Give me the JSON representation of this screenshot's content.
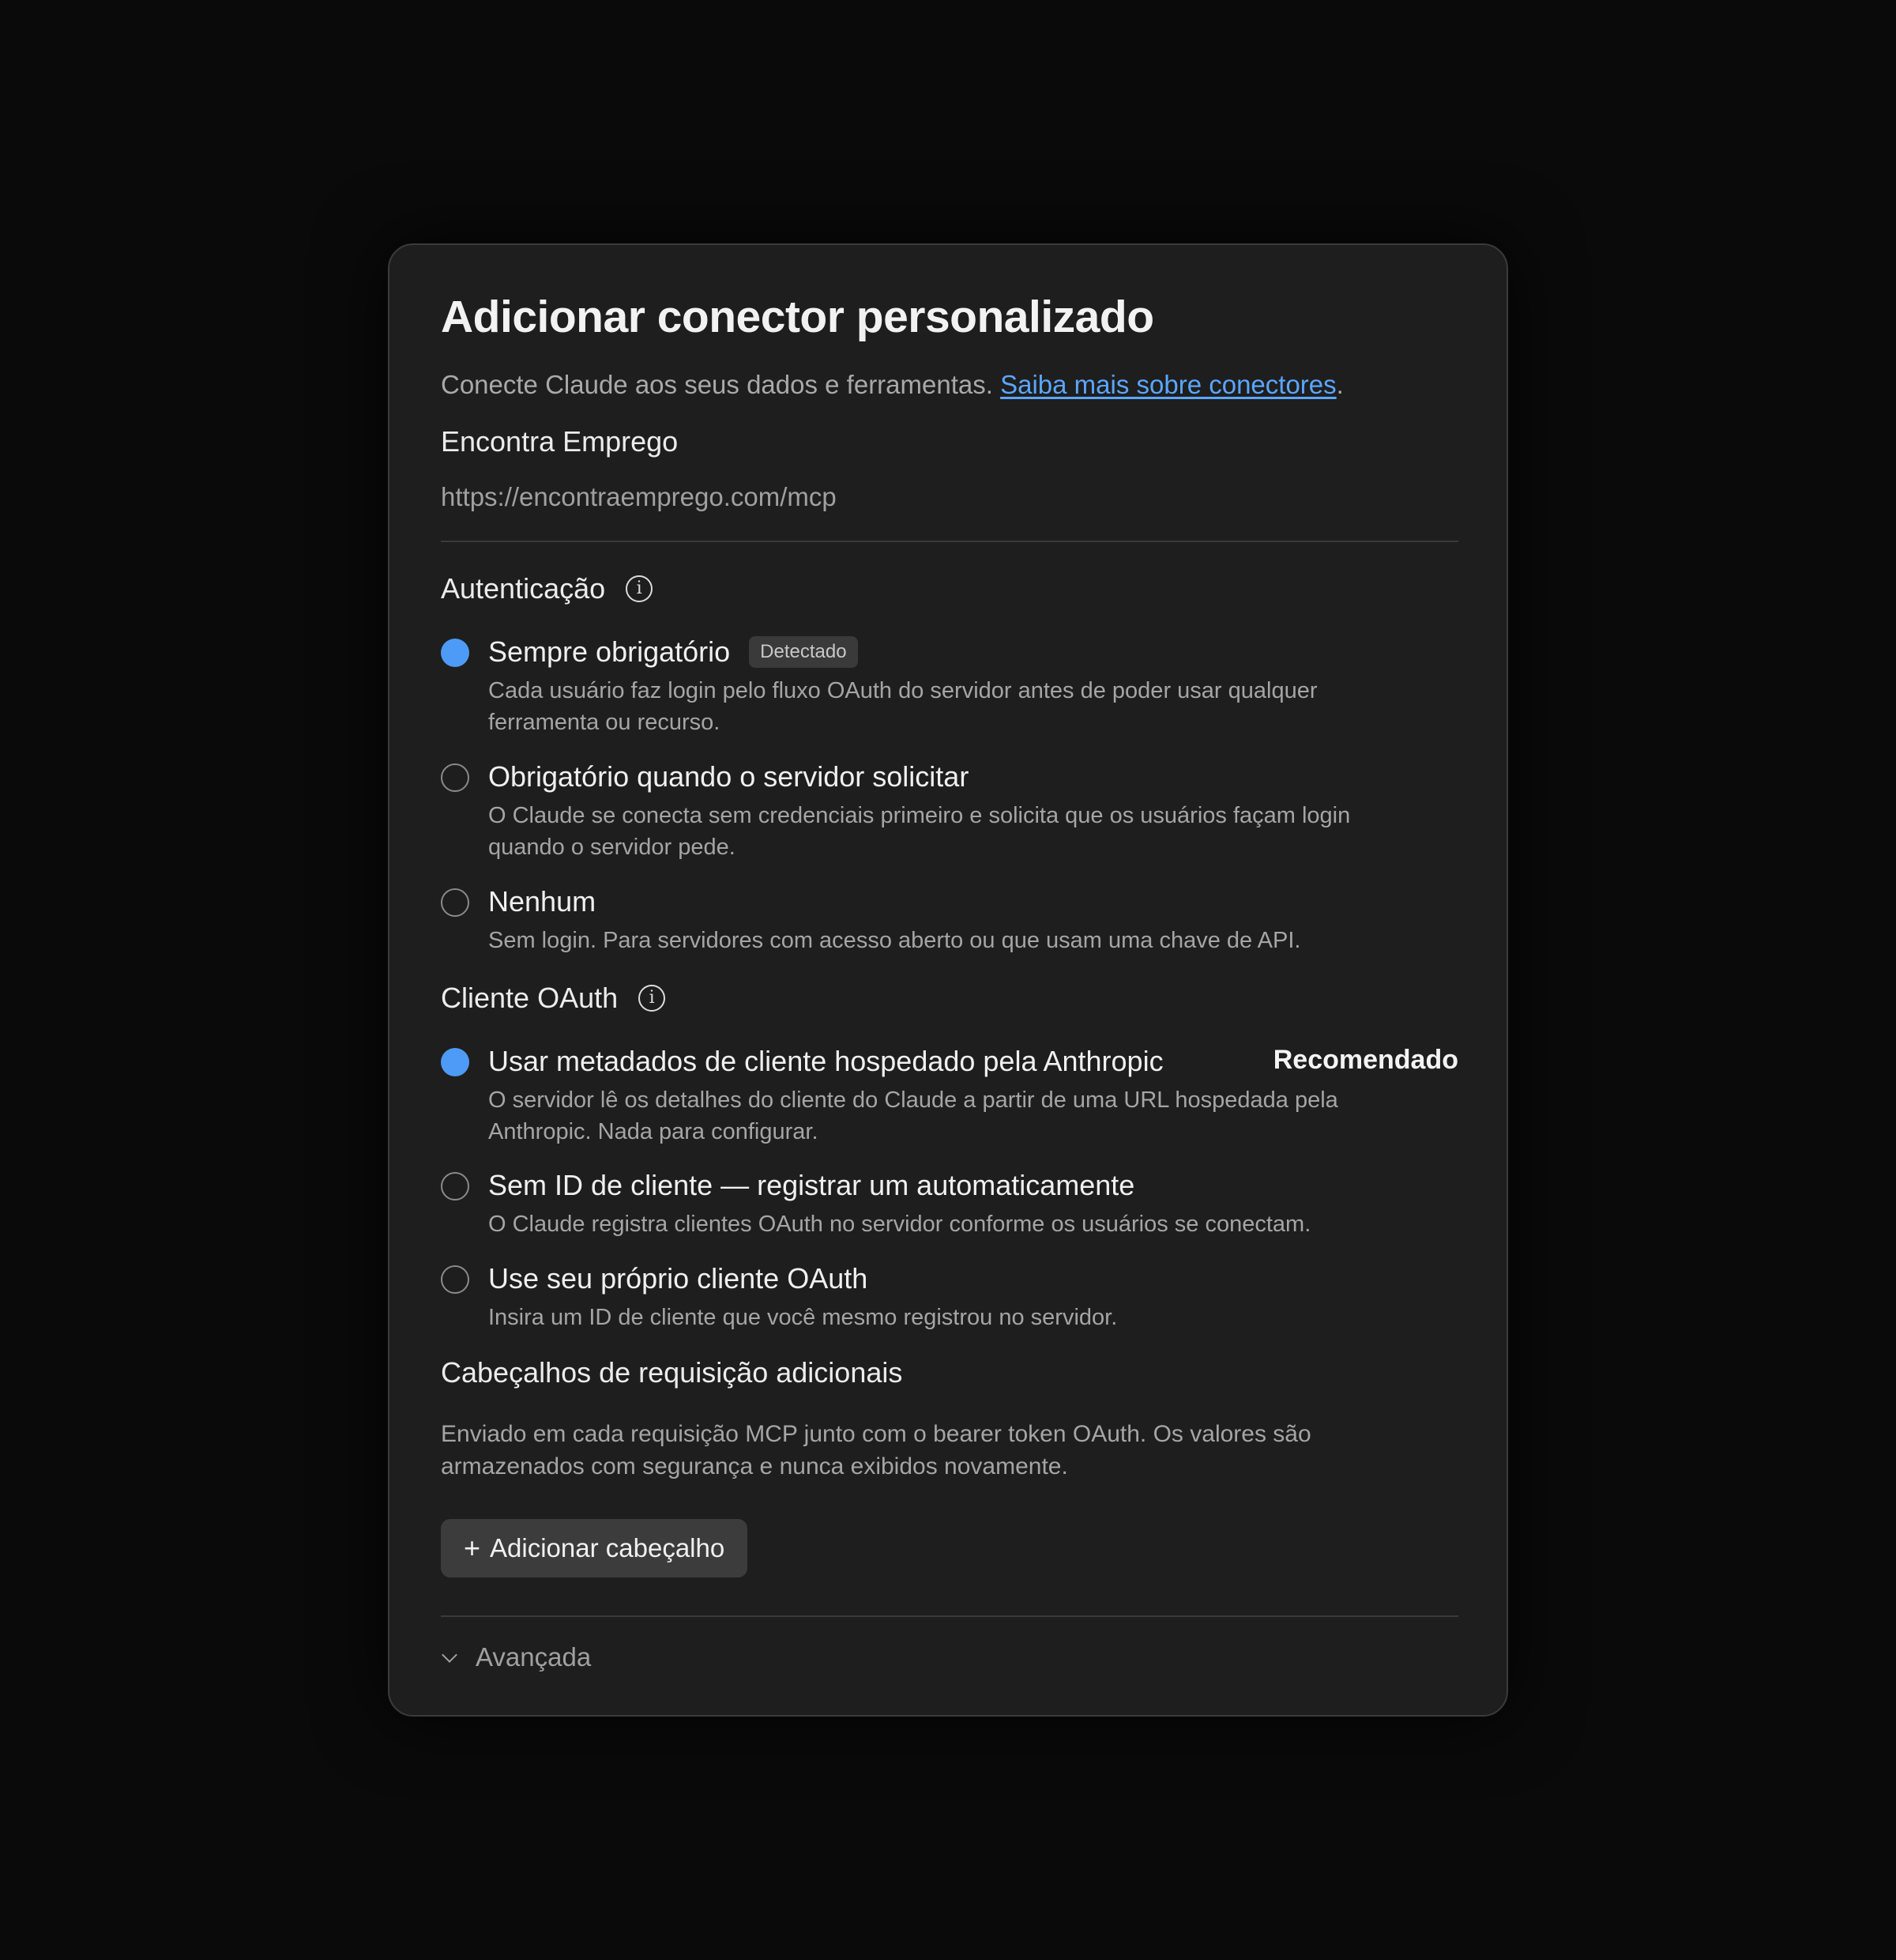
{
  "dialog": {
    "title": "Adicionar conector personalizado",
    "subtitle_text": "Conecte Claude aos seus dados e ferramentas.",
    "subtitle_link": "Saiba mais sobre conectores",
    "subtitle_end": "."
  },
  "form": {
    "name_value": "Encontra Emprego",
    "url_value": "https://encontraemprego.com/mcp"
  },
  "auth": {
    "title": "Autenticação",
    "info_icon": "info-icon",
    "options": [
      {
        "label": "Sempre obrigatório",
        "badge": "Detectado",
        "description": "Cada usuário faz login pelo fluxo OAuth do servidor antes de poder usar qualquer ferramenta ou recurso.",
        "selected": true
      },
      {
        "label": "Obrigatório quando o servidor solicitar",
        "description": "O Claude se conecta sem credenciais primeiro e solicita que os usuários façam login quando o servidor pede.",
        "selected": false
      },
      {
        "label": "Nenhum",
        "description": "Sem login. Para servidores com acesso aberto ou que usam uma chave de API.",
        "selected": false
      }
    ]
  },
  "oauth_client": {
    "title": "Cliente OAuth",
    "info_icon": "info-icon",
    "options": [
      {
        "label": "Usar metadados de cliente hospedado pela Anthropic",
        "tag": "Recomendado",
        "description": "O servidor lê os detalhes do cliente do Claude a partir de uma URL hospedada pela Anthropic. Nada para configurar.",
        "selected": true
      },
      {
        "label": "Sem ID de cliente — registrar um automaticamente",
        "description": "O Claude registra clientes OAuth no servidor conforme os usuários se conectam.",
        "selected": false
      },
      {
        "label": "Use seu próprio cliente OAuth",
        "description": "Insira um ID de cliente que você mesmo registrou no servidor.",
        "selected": false
      }
    ]
  },
  "headers": {
    "title": "Cabeçalhos de requisição adicionais",
    "description": "Enviado em cada requisição MCP junto com o bearer token OAuth. Os valores são armazenados com segurança e nunca exibidos novamente.",
    "add_button_icon": "+",
    "add_button_label": "Adicionar cabeçalho"
  },
  "advanced": {
    "label": "Avançada",
    "icon": "chevron-down-icon"
  },
  "colors": {
    "accent": "#4d9bf7",
    "link": "#5aa6ff",
    "dialog_bg": "#1e1e1e"
  }
}
